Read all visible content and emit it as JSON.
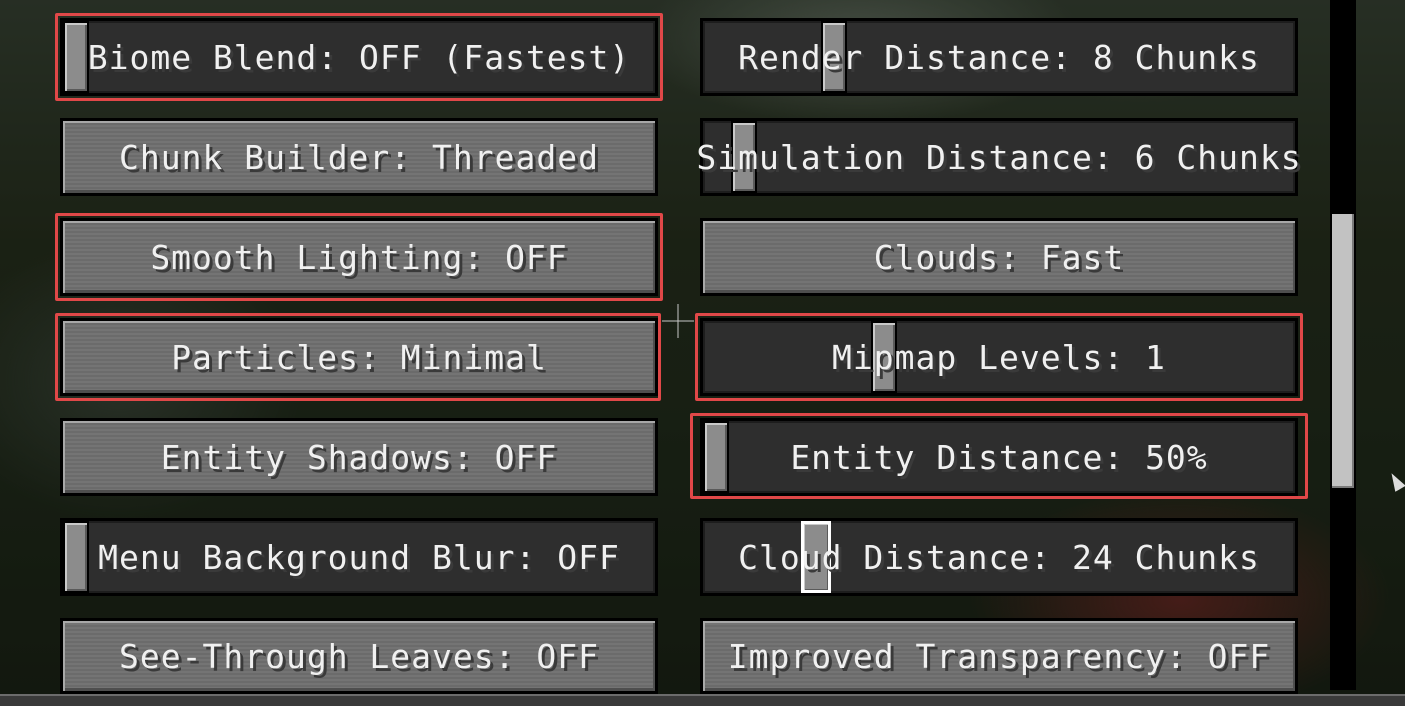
{
  "left_column": [
    {
      "id": "biome-blend",
      "label": "Biome Blend: OFF (Fastest)",
      "kind": "slider",
      "level": 0.0
    },
    {
      "id": "chunk-builder",
      "label": "Chunk Builder: Threaded",
      "kind": "button"
    },
    {
      "id": "smooth-lighting",
      "label": "Smooth Lighting: OFF",
      "kind": "button"
    },
    {
      "id": "particles",
      "label": "Particles: Minimal",
      "kind": "button"
    },
    {
      "id": "entity-shadows",
      "label": "Entity Shadows: OFF",
      "kind": "button"
    },
    {
      "id": "menu-blur",
      "label": "Menu Background Blur: OFF",
      "kind": "slider",
      "level": 0.0
    },
    {
      "id": "see-through-leaves",
      "label": "See-Through Leaves: OFF",
      "kind": "button"
    }
  ],
  "right_column": [
    {
      "id": "render-distance",
      "label": "Render Distance: 8 Chunks",
      "kind": "slider",
      "level": 0.21
    },
    {
      "id": "simulation-distance",
      "label": "Simulation Distance: 6 Chunks",
      "kind": "slider",
      "level": 0.06
    },
    {
      "id": "clouds",
      "label": "Clouds: Fast",
      "kind": "button"
    },
    {
      "id": "mipmap-levels",
      "label": "Mipmap Levels: 1",
      "kind": "slider",
      "level": 0.25
    },
    {
      "id": "entity-distance",
      "label": "Entity Distance: 50%",
      "kind": "slider",
      "level": 0.0
    },
    {
      "id": "cloud-distance",
      "label": "Cloud Distance: 24 Chunks",
      "kind": "slider",
      "level": 0.19
    },
    {
      "id": "improved-transparency",
      "label": "Improved Transparency: OFF",
      "kind": "button"
    }
  ],
  "highlighted": [
    "biome-blend",
    "smooth-lighting",
    "particles",
    "mipmap-levels",
    "entity-distance"
  ],
  "scrollbar": {
    "position": 0.31
  },
  "colors": {
    "highlight": "#e04848",
    "button": "#6f6f6f",
    "slider": "#2e2e2e",
    "text": "#f0f0f0"
  }
}
